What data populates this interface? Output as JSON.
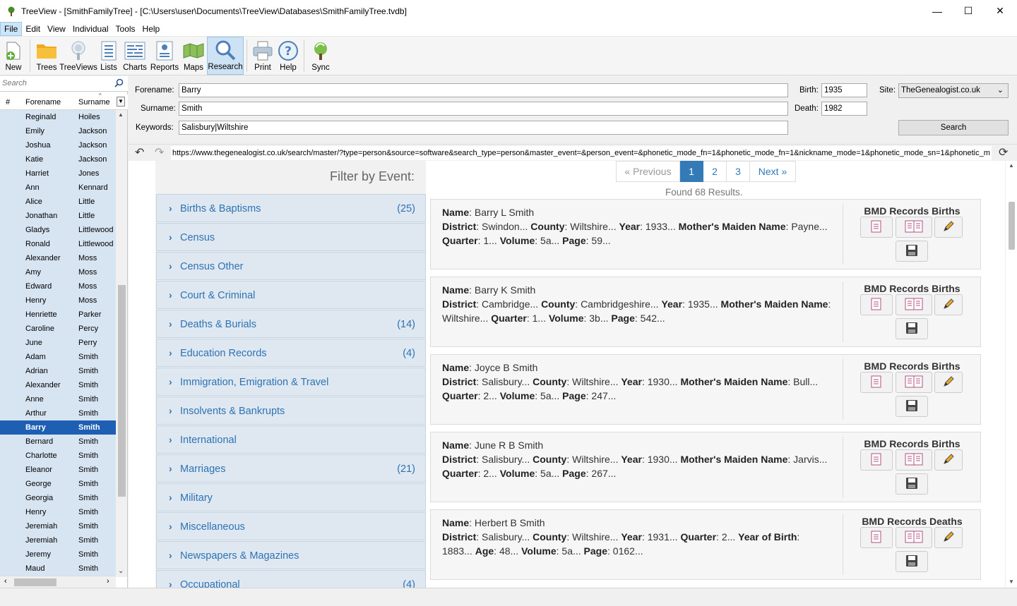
{
  "window": {
    "title": "TreeView - [SmithFamilyTree] - [C:\\Users\\user\\Documents\\TreeView\\Databases\\SmithFamilyTree.tvdb]",
    "minimize": "—",
    "maximize": "☐",
    "close": "✕"
  },
  "menu": [
    "File",
    "Edit",
    "View",
    "Individual",
    "Tools",
    "Help"
  ],
  "toolbar": {
    "new": "New",
    "trees": "Trees",
    "treeviews": "TreeViews",
    "lists": "Lists",
    "charts": "Charts",
    "reports": "Reports",
    "maps": "Maps",
    "research": "Research",
    "print": "Print",
    "help": "Help",
    "sync": "Sync"
  },
  "sidebar": {
    "search_placeholder": "Search",
    "col_num": "#",
    "col_forename": "Forename",
    "col_surname": "Surname",
    "people": [
      {
        "forename": "Reginald",
        "surname": "Hoiles"
      },
      {
        "forename": "Emily",
        "surname": "Jackson"
      },
      {
        "forename": "Joshua",
        "surname": "Jackson"
      },
      {
        "forename": "Katie",
        "surname": "Jackson"
      },
      {
        "forename": "Harriet",
        "surname": "Jones"
      },
      {
        "forename": "Ann",
        "surname": "Kennard"
      },
      {
        "forename": "Alice",
        "surname": "Little"
      },
      {
        "forename": "Jonathan",
        "surname": "Little"
      },
      {
        "forename": "Gladys",
        "surname": "Littlewood"
      },
      {
        "forename": "Ronald",
        "surname": "Littlewood"
      },
      {
        "forename": "Alexander",
        "surname": "Moss"
      },
      {
        "forename": "Amy",
        "surname": "Moss"
      },
      {
        "forename": "Edward",
        "surname": "Moss"
      },
      {
        "forename": "Henry",
        "surname": "Moss"
      },
      {
        "forename": "Henriette",
        "surname": "Parker"
      },
      {
        "forename": "Caroline",
        "surname": "Percy"
      },
      {
        "forename": "June",
        "surname": "Perry"
      },
      {
        "forename": "Adam",
        "surname": "Smith"
      },
      {
        "forename": "Adrian",
        "surname": "Smith"
      },
      {
        "forename": "Alexander",
        "surname": "Smith"
      },
      {
        "forename": "Anne",
        "surname": "Smith"
      },
      {
        "forename": "Arthur",
        "surname": "Smith"
      },
      {
        "forename": "Barry",
        "surname": "Smith"
      },
      {
        "forename": "Bernard",
        "surname": "Smith"
      },
      {
        "forename": "Charlotte",
        "surname": "Smith"
      },
      {
        "forename": "Eleanor",
        "surname": "Smith"
      },
      {
        "forename": "George",
        "surname": "Smith"
      },
      {
        "forename": "Georgia",
        "surname": "Smith"
      },
      {
        "forename": "Henry",
        "surname": "Smith"
      },
      {
        "forename": "Jeremiah",
        "surname": "Smith"
      },
      {
        "forename": "Jeremiah",
        "surname": "Smith"
      },
      {
        "forename": "Jeremy",
        "surname": "Smith"
      },
      {
        "forename": "Maud",
        "surname": "Smith"
      }
    ]
  },
  "form": {
    "forename_label": "Forename:",
    "forename_value": "Barry",
    "surname_label": "Surname:",
    "surname_value": "Smith",
    "keywords_label": "Keywords:",
    "keywords_value": "Salisbury|Wiltshire",
    "birth_label": "Birth:",
    "birth_value": "1935",
    "death_label": "Death:",
    "death_value": "1982",
    "site_label": "Site:",
    "site_value": "TheGenealogist.co.uk",
    "search_button": "Search"
  },
  "url": "https://www.thegenealogist.co.uk/search/master/?type=person&source=software&search_type=person&master_event=&person_event=&phonetic_mode_fn=1&phonetic_mode_fn=1&nickname_mode=1&phonetic_mode_sn=1&phonetic_m",
  "filter": {
    "title": "Filter by Event:",
    "events": [
      {
        "label": "Births & Baptisms",
        "count": "(25)"
      },
      {
        "label": "Census",
        "count": ""
      },
      {
        "label": "Census Other",
        "count": ""
      },
      {
        "label": "Court & Criminal",
        "count": ""
      },
      {
        "label": "Deaths & Burials",
        "count": "(14)"
      },
      {
        "label": "Education Records",
        "count": "(4)"
      },
      {
        "label": "Immigration, Emigration & Travel",
        "count": ""
      },
      {
        "label": "Insolvents & Bankrupts",
        "count": ""
      },
      {
        "label": "International",
        "count": ""
      },
      {
        "label": "Marriages",
        "count": "(21)"
      },
      {
        "label": "Military",
        "count": ""
      },
      {
        "label": "Miscellaneous",
        "count": ""
      },
      {
        "label": "Newspapers & Magazines",
        "count": ""
      },
      {
        "label": "Occupational",
        "count": "(4)"
      }
    ]
  },
  "pager": {
    "prev": "« Previous",
    "pages": [
      "1",
      "2",
      "3"
    ],
    "next": "Next »",
    "found": "Found 68 Results."
  },
  "results": [
    {
      "source": "BMD Records Births",
      "lines": [
        [
          [
            "Name",
            "Barry L Smith"
          ]
        ],
        [
          [
            "District",
            "Swindon..."
          ],
          [
            "County",
            "Wiltshire..."
          ],
          [
            "Year",
            "1933..."
          ],
          [
            "Mother's Maiden Name",
            "Payne..."
          ]
        ],
        [
          [
            "Quarter",
            "1..."
          ],
          [
            "Volume",
            "5a..."
          ],
          [
            "Page",
            "59..."
          ]
        ]
      ]
    },
    {
      "source": "BMD Records Births",
      "lines": [
        [
          [
            "Name",
            "Barry K Smith"
          ]
        ],
        [
          [
            "District",
            "Cambridge..."
          ],
          [
            "County",
            "Cambridgeshire..."
          ],
          [
            "Year",
            "1935..."
          ],
          [
            "Mother's Maiden Name",
            ""
          ]
        ],
        [
          [
            "",
            "Wiltshire..."
          ],
          [
            "Quarter",
            "1..."
          ],
          [
            "Volume",
            "3b..."
          ],
          [
            "Page",
            "542..."
          ]
        ]
      ]
    },
    {
      "source": "BMD Records Births",
      "lines": [
        [
          [
            "Name",
            "Joyce B Smith"
          ]
        ],
        [
          [
            "District",
            "Salisbury..."
          ],
          [
            "County",
            "Wiltshire..."
          ],
          [
            "Year",
            "1930..."
          ],
          [
            "Mother's Maiden Name",
            "Bull..."
          ]
        ],
        [
          [
            "Quarter",
            "2..."
          ],
          [
            "Volume",
            "5a..."
          ],
          [
            "Page",
            "247..."
          ]
        ]
      ]
    },
    {
      "source": "BMD Records Births",
      "lines": [
        [
          [
            "Name",
            "June R B Smith"
          ]
        ],
        [
          [
            "District",
            "Salisbury..."
          ],
          [
            "County",
            "Wiltshire..."
          ],
          [
            "Year",
            "1930..."
          ],
          [
            "Mother's Maiden Name",
            "Jarvis..."
          ]
        ],
        [
          [
            "Quarter",
            "2..."
          ],
          [
            "Volume",
            "5a..."
          ],
          [
            "Page",
            "267..."
          ]
        ]
      ]
    },
    {
      "source": "BMD Records Deaths",
      "lines": [
        [
          [
            "Name",
            "Herbert B Smith"
          ]
        ],
        [
          [
            "District",
            "Salisbury..."
          ],
          [
            "County",
            "Wiltshire..."
          ],
          [
            "Year",
            "1931..."
          ],
          [
            "Quarter",
            "2..."
          ],
          [
            "Year of Birth",
            ""
          ]
        ],
        [
          [
            "",
            "1883..."
          ],
          [
            "Age",
            "48..."
          ],
          [
            "Volume",
            "5a..."
          ],
          [
            "Page",
            "0162..."
          ]
        ]
      ]
    }
  ],
  "icons": {
    "new": "new-person-icon",
    "trees": "folder-icon",
    "treeviews": "tree-icon",
    "lists": "list-icon",
    "charts": "chart-icon",
    "reports": "report-icon",
    "maps": "map-icon",
    "research": "magnifier-icon",
    "print": "printer-icon",
    "help": "question-icon",
    "sync": "sync-icon"
  },
  "colors": {
    "selection": "#1f5fb3",
    "link": "#2d73b4",
    "active_page": "#337ab7",
    "filter_bg": "#dfe8f1"
  }
}
